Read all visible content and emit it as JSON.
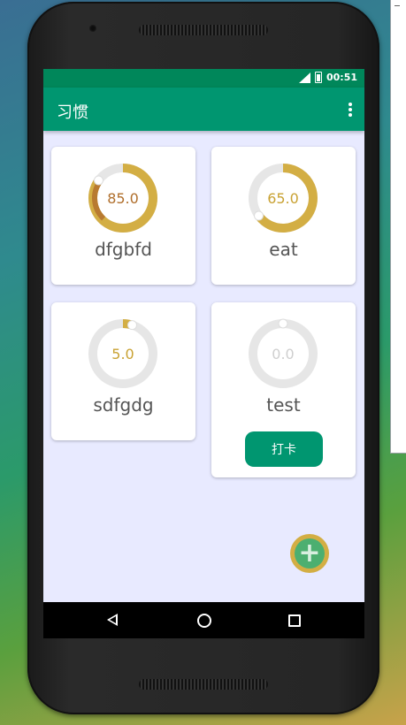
{
  "status_bar": {
    "signal_label": "LTE",
    "time": "00:51"
  },
  "app_bar": {
    "title": "习惯",
    "menu_icon": "more-vert-icon"
  },
  "habits": [
    {
      "name": "dfgbfd",
      "value": "85.0",
      "progress": 0.85,
      "value_color": "#b06f2c",
      "arc_color": "#d3ae44",
      "fill_color": "#b87a30",
      "has_checkin": false
    },
    {
      "name": "eat",
      "value": "65.0",
      "progress": 0.65,
      "value_color": "#c9a233",
      "arc_color": "#d3ae44",
      "fill_color": "#d3ae44",
      "has_checkin": false
    },
    {
      "name": "sdfgdg",
      "value": "5.0",
      "progress": 0.05,
      "value_color": "#c9a233",
      "arc_color": "#d3ae44",
      "fill_color": "#d3ae44",
      "has_checkin": false
    },
    {
      "name": "test",
      "value": "0.0",
      "progress": 0.0,
      "value_color": "#cfcfcf",
      "arc_color": "#d3ae44",
      "fill_color": "#d3ae44",
      "has_checkin": true,
      "checkin_label": "打卡"
    }
  ],
  "fab": {
    "label": "+",
    "icon": "add-icon"
  },
  "colors": {
    "primary": "#009670",
    "status": "#00875a",
    "background": "#e8eaff",
    "track": "#e6e6e6"
  }
}
